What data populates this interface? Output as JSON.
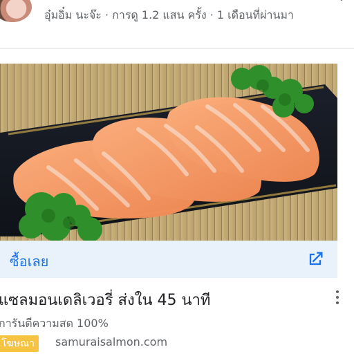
{
  "post": {
    "channel_meta": "อุ๋มอิ๋ม นะจ๊ะ · การดู 1.2 แสน ครั้ง · 1 เดือนที่ผ่านมา"
  },
  "ad": {
    "cta_label": "ซื้อเลย",
    "title": "แซลมอนเดลิเวอรี่ ส่งใน 45 นาที",
    "description": "การันตีความสด 100%",
    "badge": "โฆษณา",
    "domain": "samuraisalmon.com"
  },
  "icons": {
    "open": "open-in-new-icon",
    "more": "more-vert-icon"
  },
  "colors": {
    "cta_bg": "#e9f2fb",
    "cta_text": "#1a73e8",
    "badge": "#f6c343"
  }
}
